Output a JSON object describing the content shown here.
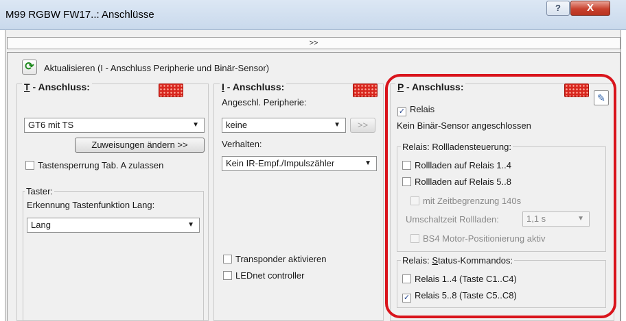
{
  "window": {
    "title": "M99 RGBW FW17..: Anschlüsse",
    "help_label": "?",
    "close_label": "X"
  },
  "expand_bar": {
    "label": ">>"
  },
  "refresh": {
    "label": "Aktualisieren (I - Anschluss Peripherie und Binär-Sensor)"
  },
  "panel_t": {
    "heading_prefix": "T",
    "heading_rest": " - Anschluss:",
    "device_select": "GT6 mit TS",
    "assign_button": "Zuweisungen ändern >>",
    "lock_checkbox": "Tastensperrung Tab. A zulassen",
    "lock_checked": false,
    "taster_group": "Taster:",
    "long_press_label": "Erkennung Tastenfunktion Lang:",
    "long_press_select": "Lang"
  },
  "panel_i": {
    "heading_prefix": "I",
    "heading_rest": " - Anschluss:",
    "peripheral_label": "Angeschl. Peripherie:",
    "peripheral_select": "keine",
    "peripheral_button": ">>",
    "behavior_label": "Verhalten:",
    "behavior_select": "Kein IR-Empf./Impulszähler",
    "transponder_checkbox": "Transponder aktivieren",
    "transponder_checked": false,
    "lednet_checkbox": "LEDnet controller",
    "lednet_checked": false
  },
  "panel_p": {
    "heading_prefix": "P",
    "heading_rest": " - Anschluss:",
    "relais_checkbox": "Relais",
    "relais_checked": true,
    "binary_sensor_status": "Kein Binär-Sensor angeschlossen",
    "shutter_group": "Relais: Rollladensteuerung:",
    "shutter_1_4": "Rollladen auf Relais 1..4",
    "shutter_5_8": "Rollladen auf Relais 5..8",
    "time_limit": "mit Zeitbegrenzung 140s",
    "switch_time_label": "Umschaltzeit Rollladen:",
    "switch_time_value": "1,1 s",
    "bs4_positioning": "BS4 Motor-Positionierung aktiv",
    "status_group_prefix": "Relais: ",
    "status_group_mnemonic": "S",
    "status_group_rest": "tatus-Kommandos:",
    "status_1_4": "Relais 1..4 (Taste C1..C4)",
    "status_1_4_checked": false,
    "status_5_8": "Relais 5..8 (Taste C5..C8)",
    "status_5_8_checked": true
  },
  "icons": {
    "connector": "connector-icon",
    "refresh": "refresh-icon",
    "edit": "edit-icon"
  },
  "colors": {
    "connector_red": "#d8271f",
    "highlight_red": "#d9141c",
    "close_red": "#c9432f"
  }
}
